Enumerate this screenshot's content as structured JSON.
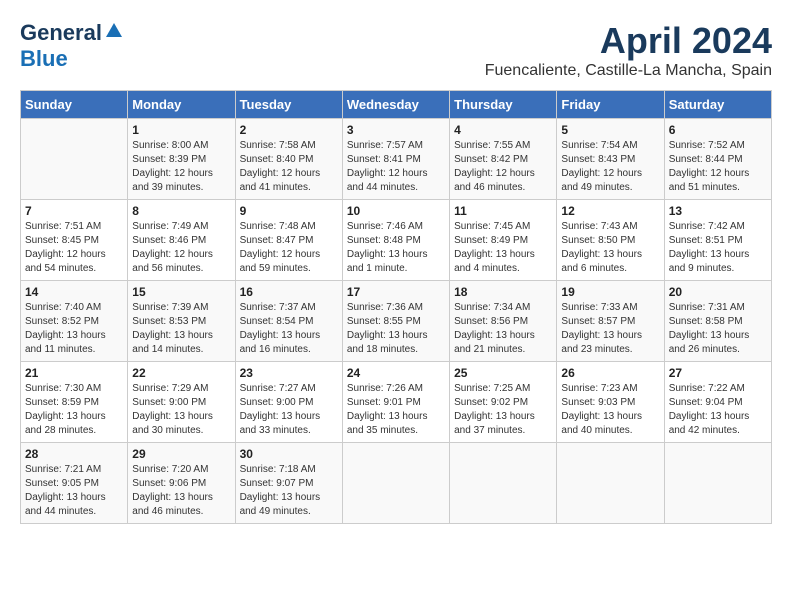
{
  "logo": {
    "line1": "General",
    "line2": "Blue"
  },
  "title": "April 2024",
  "subtitle": "Fuencaliente, Castille-La Mancha, Spain",
  "days_of_week": [
    "Sunday",
    "Monday",
    "Tuesday",
    "Wednesday",
    "Thursday",
    "Friday",
    "Saturday"
  ],
  "weeks": [
    [
      {
        "day": "",
        "content": ""
      },
      {
        "day": "1",
        "content": "Sunrise: 8:00 AM\nSunset: 8:39 PM\nDaylight: 12 hours\nand 39 minutes."
      },
      {
        "day": "2",
        "content": "Sunrise: 7:58 AM\nSunset: 8:40 PM\nDaylight: 12 hours\nand 41 minutes."
      },
      {
        "day": "3",
        "content": "Sunrise: 7:57 AM\nSunset: 8:41 PM\nDaylight: 12 hours\nand 44 minutes."
      },
      {
        "day": "4",
        "content": "Sunrise: 7:55 AM\nSunset: 8:42 PM\nDaylight: 12 hours\nand 46 minutes."
      },
      {
        "day": "5",
        "content": "Sunrise: 7:54 AM\nSunset: 8:43 PM\nDaylight: 12 hours\nand 49 minutes."
      },
      {
        "day": "6",
        "content": "Sunrise: 7:52 AM\nSunset: 8:44 PM\nDaylight: 12 hours\nand 51 minutes."
      }
    ],
    [
      {
        "day": "7",
        "content": "Sunrise: 7:51 AM\nSunset: 8:45 PM\nDaylight: 12 hours\nand 54 minutes."
      },
      {
        "day": "8",
        "content": "Sunrise: 7:49 AM\nSunset: 8:46 PM\nDaylight: 12 hours\nand 56 minutes."
      },
      {
        "day": "9",
        "content": "Sunrise: 7:48 AM\nSunset: 8:47 PM\nDaylight: 12 hours\nand 59 minutes."
      },
      {
        "day": "10",
        "content": "Sunrise: 7:46 AM\nSunset: 8:48 PM\nDaylight: 13 hours\nand 1 minute."
      },
      {
        "day": "11",
        "content": "Sunrise: 7:45 AM\nSunset: 8:49 PM\nDaylight: 13 hours\nand 4 minutes."
      },
      {
        "day": "12",
        "content": "Sunrise: 7:43 AM\nSunset: 8:50 PM\nDaylight: 13 hours\nand 6 minutes."
      },
      {
        "day": "13",
        "content": "Sunrise: 7:42 AM\nSunset: 8:51 PM\nDaylight: 13 hours\nand 9 minutes."
      }
    ],
    [
      {
        "day": "14",
        "content": "Sunrise: 7:40 AM\nSunset: 8:52 PM\nDaylight: 13 hours\nand 11 minutes."
      },
      {
        "day": "15",
        "content": "Sunrise: 7:39 AM\nSunset: 8:53 PM\nDaylight: 13 hours\nand 14 minutes."
      },
      {
        "day": "16",
        "content": "Sunrise: 7:37 AM\nSunset: 8:54 PM\nDaylight: 13 hours\nand 16 minutes."
      },
      {
        "day": "17",
        "content": "Sunrise: 7:36 AM\nSunset: 8:55 PM\nDaylight: 13 hours\nand 18 minutes."
      },
      {
        "day": "18",
        "content": "Sunrise: 7:34 AM\nSunset: 8:56 PM\nDaylight: 13 hours\nand 21 minutes."
      },
      {
        "day": "19",
        "content": "Sunrise: 7:33 AM\nSunset: 8:57 PM\nDaylight: 13 hours\nand 23 minutes."
      },
      {
        "day": "20",
        "content": "Sunrise: 7:31 AM\nSunset: 8:58 PM\nDaylight: 13 hours\nand 26 minutes."
      }
    ],
    [
      {
        "day": "21",
        "content": "Sunrise: 7:30 AM\nSunset: 8:59 PM\nDaylight: 13 hours\nand 28 minutes."
      },
      {
        "day": "22",
        "content": "Sunrise: 7:29 AM\nSunset: 9:00 PM\nDaylight: 13 hours\nand 30 minutes."
      },
      {
        "day": "23",
        "content": "Sunrise: 7:27 AM\nSunset: 9:00 PM\nDaylight: 13 hours\nand 33 minutes."
      },
      {
        "day": "24",
        "content": "Sunrise: 7:26 AM\nSunset: 9:01 PM\nDaylight: 13 hours\nand 35 minutes."
      },
      {
        "day": "25",
        "content": "Sunrise: 7:25 AM\nSunset: 9:02 PM\nDaylight: 13 hours\nand 37 minutes."
      },
      {
        "day": "26",
        "content": "Sunrise: 7:23 AM\nSunset: 9:03 PM\nDaylight: 13 hours\nand 40 minutes."
      },
      {
        "day": "27",
        "content": "Sunrise: 7:22 AM\nSunset: 9:04 PM\nDaylight: 13 hours\nand 42 minutes."
      }
    ],
    [
      {
        "day": "28",
        "content": "Sunrise: 7:21 AM\nSunset: 9:05 PM\nDaylight: 13 hours\nand 44 minutes."
      },
      {
        "day": "29",
        "content": "Sunrise: 7:20 AM\nSunset: 9:06 PM\nDaylight: 13 hours\nand 46 minutes."
      },
      {
        "day": "30",
        "content": "Sunrise: 7:18 AM\nSunset: 9:07 PM\nDaylight: 13 hours\nand 49 minutes."
      },
      {
        "day": "",
        "content": ""
      },
      {
        "day": "",
        "content": ""
      },
      {
        "day": "",
        "content": ""
      },
      {
        "day": "",
        "content": ""
      }
    ]
  ]
}
